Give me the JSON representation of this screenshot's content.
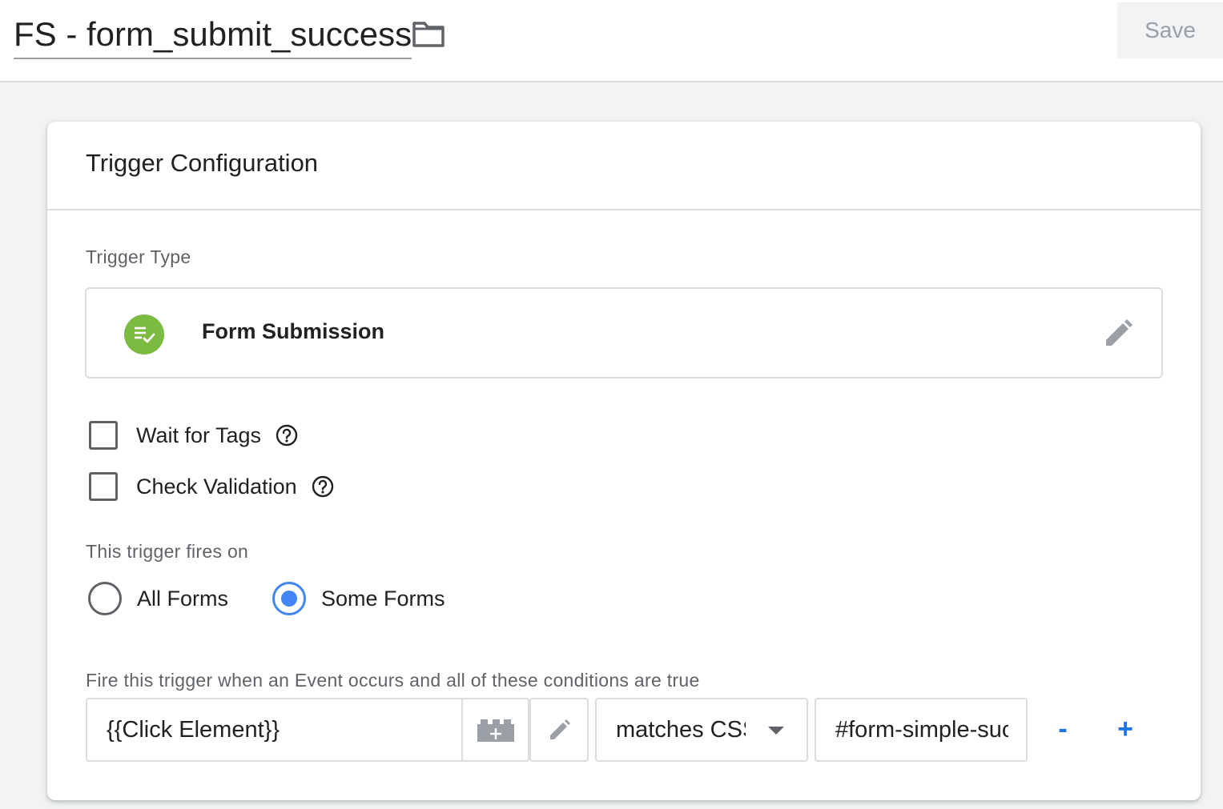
{
  "header": {
    "title": "FS - form_submit_success",
    "folder_icon": "folder-icon",
    "save_label": "Save"
  },
  "card": {
    "title": "Trigger Configuration",
    "trigger_type_label": "Trigger Type",
    "trigger_type": {
      "name": "Form Submission",
      "icon": "form-submission-icon",
      "icon_color": "#7cbb42",
      "edit_icon": "pencil-icon"
    },
    "options": [
      {
        "label": "Wait for Tags",
        "checked": false,
        "help_icon": "help-icon"
      },
      {
        "label": "Check Validation",
        "checked": false,
        "help_icon": "help-icon"
      }
    ],
    "fires_on_label": "This trigger fires on",
    "fires_on": [
      {
        "label": "All Forms",
        "selected": false
      },
      {
        "label": "Some Forms",
        "selected": true
      }
    ],
    "conditions_label": "Fire this trigger when an Event occurs and all of these conditions are true",
    "condition": {
      "variable": "{{Click Element}}",
      "operator": "matches CSS selector",
      "value": "#form-simple-success",
      "remove_label": "-",
      "add_label": "+"
    }
  },
  "colors": {
    "accent": "#4285f4",
    "link": "#1a73e8",
    "border": "#dadce0"
  }
}
